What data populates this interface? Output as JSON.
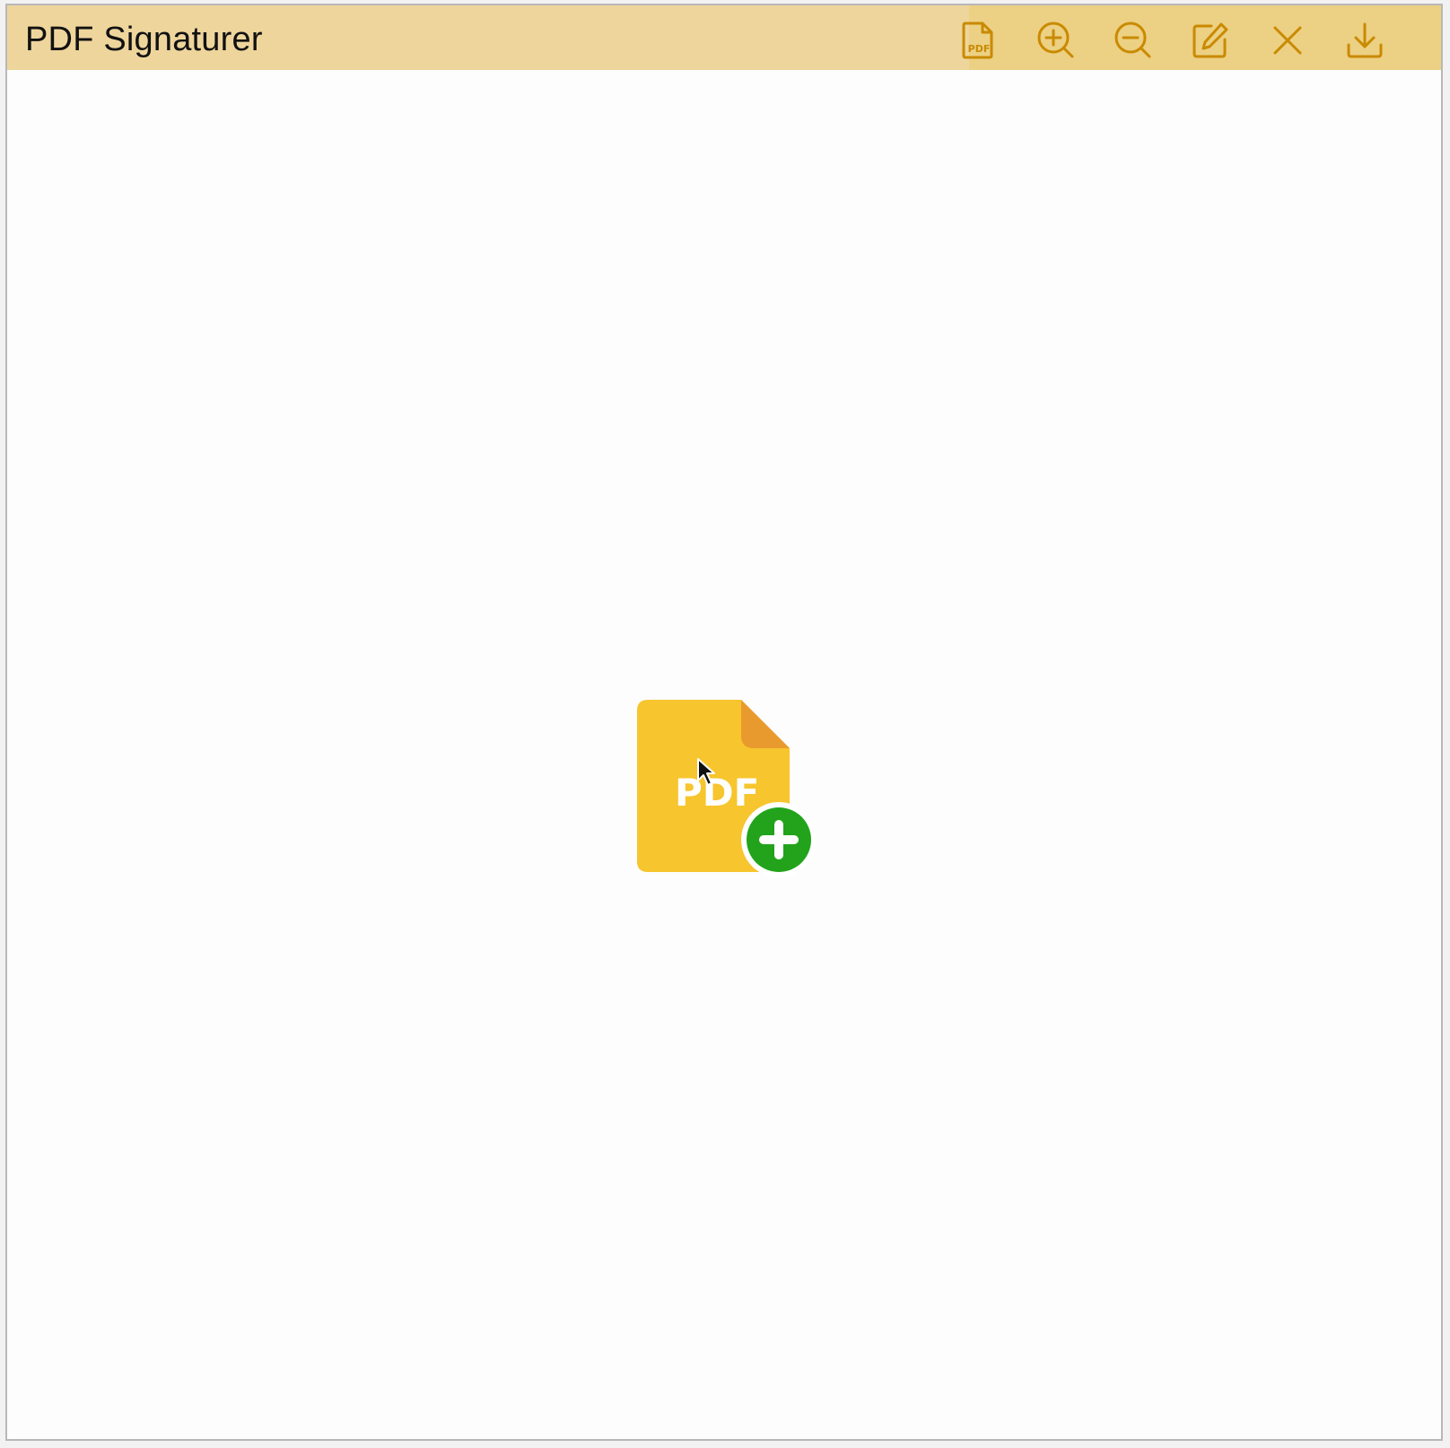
{
  "app": {
    "title": "PDF Signaturer"
  },
  "toolbar": {
    "buttons": [
      {
        "name": "open-pdf-button",
        "icon": "pdf-file-icon",
        "label": "PDF"
      },
      {
        "name": "zoom-in-button",
        "icon": "zoom-in-icon"
      },
      {
        "name": "zoom-out-button",
        "icon": "zoom-out-icon"
      },
      {
        "name": "edit-button",
        "icon": "edit-icon"
      },
      {
        "name": "close-button",
        "icon": "close-icon"
      },
      {
        "name": "download-button",
        "icon": "download-icon"
      }
    ]
  },
  "upload": {
    "icon": "pdf-add-icon",
    "label": "PDF"
  },
  "colors": {
    "titlebar": "#eed59c",
    "toolbar_area": "#ecd083",
    "icon": "#c98a00",
    "file": "#f7c52d",
    "file_fold": "#e99a2e",
    "plus_badge": "#22a31b",
    "content_bg": "#fdfdfd"
  }
}
